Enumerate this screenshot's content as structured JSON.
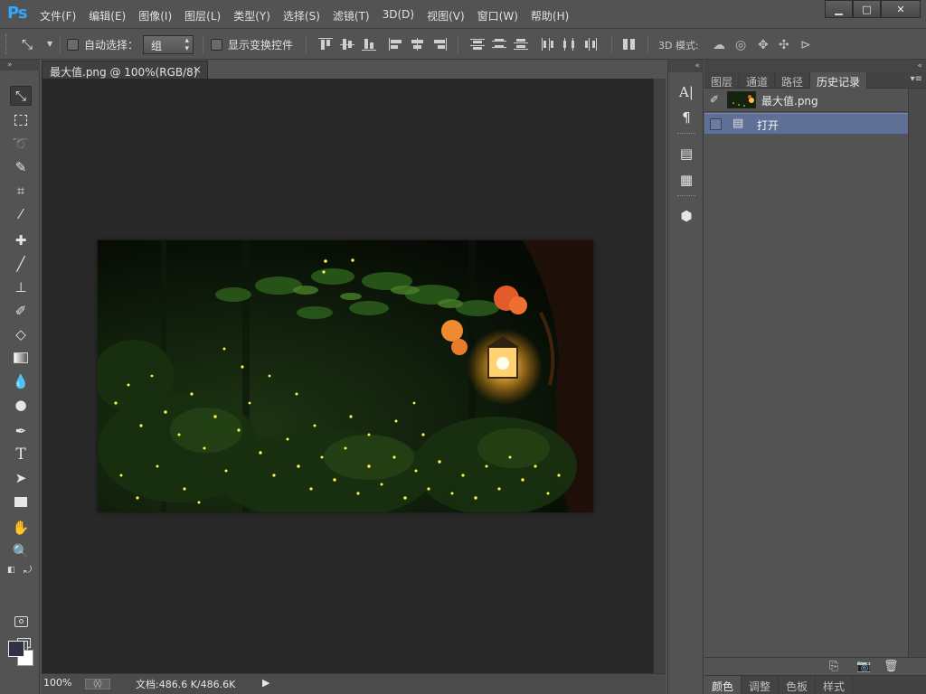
{
  "app": {
    "logo": "Ps"
  },
  "menus": [
    "文件(F)",
    "编辑(E)",
    "图像(I)",
    "图层(L)",
    "类型(Y)",
    "选择(S)",
    "滤镜(T)",
    "3D(D)",
    "视图(V)",
    "窗口(W)",
    "帮助(H)"
  ],
  "window_buttons": {
    "minimize": "▁",
    "maximize": "□",
    "close": "✕"
  },
  "options_bar": {
    "auto_select_label": "自动选择：",
    "auto_select_value": "组",
    "show_transform_label": "显示变换控件",
    "mode_3d_label": "3D 模式:"
  },
  "document_tab": {
    "title": "最大值.png @ 100%(RGB/8)",
    "close": "×"
  },
  "status_bar": {
    "zoom": "100%",
    "doc_info": "文档:486.6 K/486.6K",
    "arrow": "▶"
  },
  "panel": {
    "tabs": [
      "图层",
      "通道",
      "路径",
      "历史记录"
    ],
    "active_tab": "历史记录",
    "snapshot_label": "最大值.png",
    "history_items": [
      "打开"
    ],
    "bottom_tabs": [
      "颜色",
      "调整",
      "色板",
      "样式"
    ],
    "active_bottom_tab": "颜色"
  },
  "colors": {
    "foreground": "#2f3342",
    "background": "#ffffff",
    "selection": "#5f6f95"
  },
  "icons": {
    "tools": [
      "move-tool-icon",
      "marquee-tool-icon",
      "lasso-tool-icon",
      "quick-selection-icon",
      "crop-tool-icon",
      "eyedropper-icon",
      "healing-brush-icon",
      "brush-tool-icon",
      "clone-stamp-icon",
      "history-brush-icon",
      "eraser-icon",
      "gradient-icon",
      "blur-icon",
      "dodge-icon",
      "pen-tool-icon",
      "type-tool-icon",
      "path-selection-icon",
      "rectangle-tool-icon",
      "hand-tool-icon",
      "zoom-tool-icon",
      "quick-mask-icon",
      "screen-mode-icon"
    ]
  }
}
